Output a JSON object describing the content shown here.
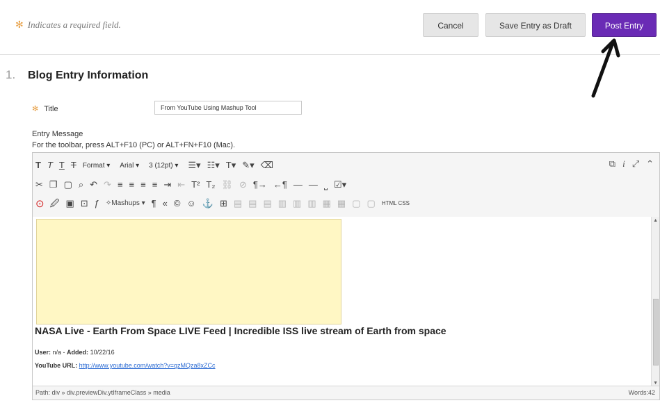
{
  "header": {
    "required_note": "Indicates a required field.",
    "cancel_label": "Cancel",
    "draft_label": "Save Entry as Draft",
    "post_label": "Post Entry"
  },
  "section": {
    "number": "1.",
    "title": "Blog Entry Information"
  },
  "form": {
    "title_label": "Title",
    "title_value": "From YouTube Using Mashup Tool",
    "entry_label": "Entry Message",
    "entry_help": "For the toolbar, press ALT+F10 (PC) or ALT+FN+F10 (Mac)."
  },
  "toolbar": {
    "format_label": "Format",
    "font_label": "Arial",
    "size_label": "3 (12pt)",
    "mashups_label": "Mashups",
    "html_label": "HTML CSS"
  },
  "content": {
    "video_title": "NASA Live - Earth From Space LIVE Feed | Incredible ISS live stream of Earth from space",
    "user_label": "User:",
    "user_value": "n/a",
    "added_label": "Added:",
    "added_value": "10/22/16",
    "url_label": "YouTube URL:",
    "url_value": "http://www.youtube.com/watch?v=qzMQza8xZCc"
  },
  "footer": {
    "path": "Path: div » div.previewDiv.ytIframeClass » media",
    "words": "Words:42"
  },
  "colors": {
    "post_button": "#6a2bb5",
    "required_star": "#e8a24a",
    "video_placeholder": "#fff7c4"
  }
}
